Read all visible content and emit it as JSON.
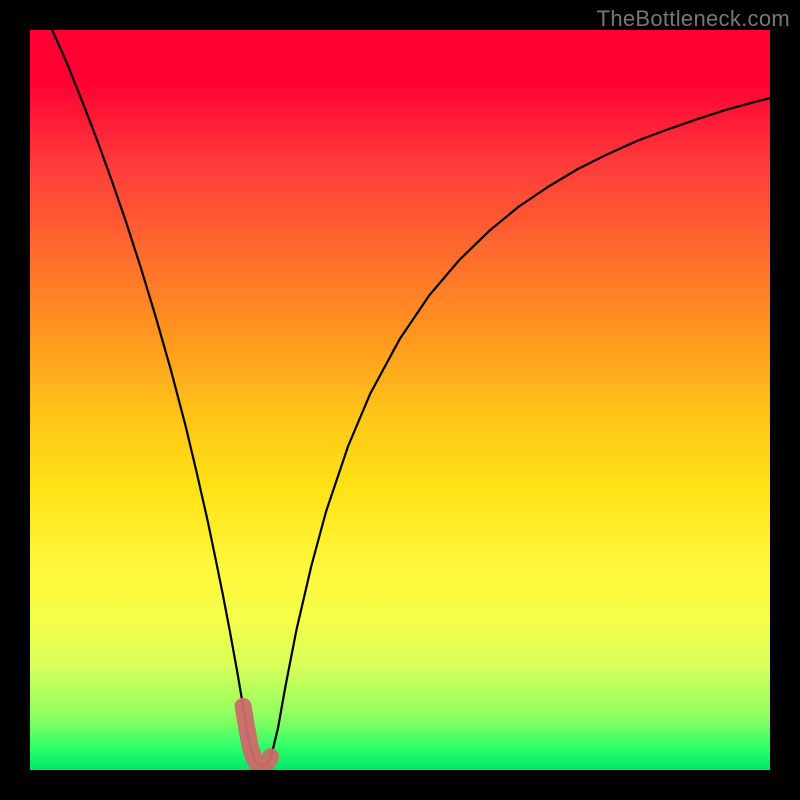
{
  "attribution": "TheBottleneck.com",
  "colors": {
    "background": "#000000",
    "gradient_top": "#ff0033",
    "gradient_bottom": "#00e56b",
    "curve": "#000000",
    "highlight": "#cc6a6a"
  },
  "chart_data": {
    "type": "line",
    "title": "",
    "xlabel": "",
    "ylabel": "",
    "xlim": [
      0,
      100
    ],
    "ylim": [
      0,
      100
    ],
    "x": [
      3,
      5,
      7,
      9,
      11,
      13,
      15,
      17,
      19,
      21,
      22.5,
      24,
      25,
      26,
      27,
      28,
      28.8,
      29.7,
      30.5,
      31,
      31.8,
      32.5,
      33.5,
      34.5,
      36,
      38,
      40,
      43,
      46,
      50,
      54,
      58,
      62,
      66,
      70,
      74,
      78,
      82,
      86,
      90,
      94,
      98,
      100
    ],
    "y": [
      100,
      95.5,
      90.5,
      85.3,
      79.8,
      74.0,
      67.8,
      61.2,
      54.2,
      46.6,
      40.3,
      33.7,
      28.9,
      24.0,
      18.8,
      13.3,
      8.6,
      3.2,
      1.1,
      0.6,
      0.6,
      1.5,
      5.6,
      11.2,
      18.9,
      27.5,
      34.9,
      43.8,
      50.9,
      58.3,
      64.2,
      68.9,
      72.8,
      76.1,
      78.8,
      81.2,
      83.2,
      85.0,
      86.5,
      87.9,
      89.2,
      90.3,
      90.8
    ],
    "highlight": {
      "x": [
        28.8,
        29.3,
        29.8,
        30.2,
        30.6,
        31.0,
        31.4,
        31.8,
        32.2,
        32.5
      ],
      "y": [
        8.6,
        5.6,
        3.0,
        1.7,
        1.0,
        0.6,
        0.6,
        0.8,
        1.2,
        1.8
      ]
    },
    "grid": false,
    "legend": false
  }
}
